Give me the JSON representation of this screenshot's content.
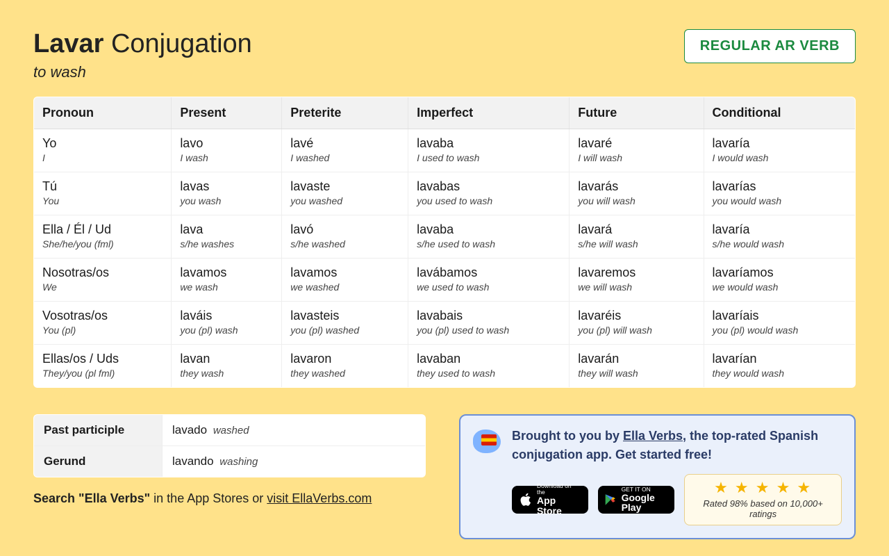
{
  "header": {
    "verb": "Lavar",
    "suffix": " Conjugation",
    "translation": "to wash",
    "badge": "REGULAR AR VERB"
  },
  "columns": [
    "Pronoun",
    "Present",
    "Preterite",
    "Imperfect",
    "Future",
    "Conditional"
  ],
  "rows": [
    {
      "pronoun": "Yo",
      "pronoun_tr": "I",
      "present": "lavo",
      "present_tr": "I wash",
      "preterite": "lavé",
      "preterite_tr": "I washed",
      "imperfect": "lavaba",
      "imperfect_tr": "I used to wash",
      "future": "lavaré",
      "future_tr": "I will wash",
      "conditional": "lavaría",
      "conditional_tr": "I would wash"
    },
    {
      "pronoun": "Tú",
      "pronoun_tr": "You",
      "present": "lavas",
      "present_tr": "you wash",
      "preterite": "lavaste",
      "preterite_tr": "you washed",
      "imperfect": "lavabas",
      "imperfect_tr": "you used to wash",
      "future": "lavarás",
      "future_tr": "you will wash",
      "conditional": "lavarías",
      "conditional_tr": "you would wash"
    },
    {
      "pronoun": "Ella / Él / Ud",
      "pronoun_tr": "She/he/you (fml)",
      "present": "lava",
      "present_tr": "s/he washes",
      "preterite": "lavó",
      "preterite_tr": "s/he washed",
      "imperfect": "lavaba",
      "imperfect_tr": "s/he used to wash",
      "future": "lavará",
      "future_tr": "s/he will wash",
      "conditional": "lavaría",
      "conditional_tr": "s/he would wash"
    },
    {
      "pronoun": "Nosotras/os",
      "pronoun_tr": "We",
      "present": "lavamos",
      "present_tr": "we wash",
      "preterite": "lavamos",
      "preterite_tr": "we washed",
      "imperfect": "lavábamos",
      "imperfect_tr": "we used to wash",
      "future": "lavaremos",
      "future_tr": "we will wash",
      "conditional": "lavaríamos",
      "conditional_tr": "we would wash"
    },
    {
      "pronoun": "Vosotras/os",
      "pronoun_tr": "You (pl)",
      "present": "laváis",
      "present_tr": "you (pl) wash",
      "preterite": "lavasteis",
      "preterite_tr": "you (pl) washed",
      "imperfect": "lavabais",
      "imperfect_tr": "you (pl) used to wash",
      "future": "lavaréis",
      "future_tr": "you (pl) will wash",
      "conditional": "lavaríais",
      "conditional_tr": "you (pl) would wash"
    },
    {
      "pronoun": "Ellas/os / Uds",
      "pronoun_tr": "They/you (pl fml)",
      "present": "lavan",
      "present_tr": "they wash",
      "preterite": "lavaron",
      "preterite_tr": "they washed",
      "imperfect": "lavaban",
      "imperfect_tr": "they used to wash",
      "future": "lavarán",
      "future_tr": "they will wash",
      "conditional": "lavarían",
      "conditional_tr": "they would wash"
    }
  ],
  "parts": {
    "pp_label": "Past participle",
    "pp_val": "lavado",
    "pp_tr": "washed",
    "ger_label": "Gerund",
    "ger_val": "lavando",
    "ger_tr": "washing"
  },
  "search": {
    "prefix": "Search \"Ella Verbs\"",
    "mid": " in the App Stores or ",
    "link": "visit EllaVerbs.com"
  },
  "promo": {
    "prefix": "Brought to you by ",
    "link": "Ella Verbs",
    "suffix": ", the top-rated Spanish conjugation app. Get started free!",
    "appstore_top": "Download on the",
    "appstore_bottom": "App Store",
    "play_top": "GET IT ON",
    "play_bottom": "Google Play",
    "rating_text": "Rated 98% based on 10,000+ ratings"
  }
}
